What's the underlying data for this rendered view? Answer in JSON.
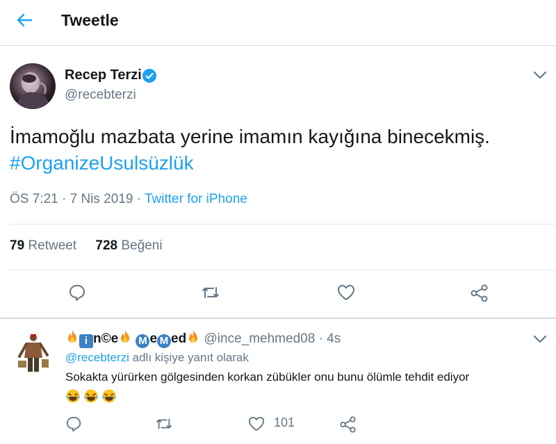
{
  "header": {
    "title": "Tweetle"
  },
  "tweet": {
    "author": {
      "name": "Recep Terzi",
      "handle": "@recebterzi"
    },
    "text_plain": "İmamoğlu mazbata yerine imamın kayığına binecekmiş.",
    "hashtag": "#OrganizeUsulsüzlük",
    "time": "ÖS 7:21",
    "date": "7 Nis 2019",
    "source": "Twitter for iPhone",
    "retweets": {
      "count": "79",
      "label": "Retweet"
    },
    "likes": {
      "count": "728",
      "label": "Beğeni"
    }
  },
  "reply": {
    "name_parts": [
      "n©e",
      "e",
      "ed"
    ],
    "name_box_letter": "i",
    "name_circle_letters": [
      "M",
      "M"
    ],
    "handle": "@ince_mehmed08",
    "time": "4s",
    "replying_mention": "@recebterzi",
    "replying_suffix": "adlı kişiye yanıt olarak",
    "text": "Sokakta yürürken gölgesinden korkan zübükler onu bunu ölümle tehdit ediyor",
    "like_count": "101"
  },
  "colors": {
    "accent": "#1da1f2",
    "muted": "#657786",
    "text": "#14171a",
    "verified": "#1da1f2"
  }
}
